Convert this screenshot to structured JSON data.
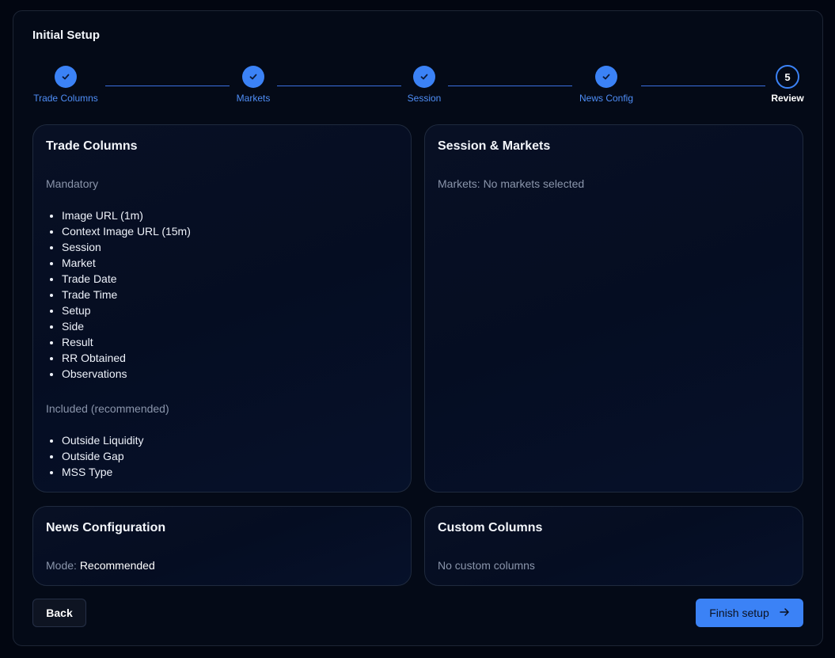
{
  "title": "Initial Setup",
  "steps": [
    {
      "label": "Trade Columns",
      "state": "done"
    },
    {
      "label": "Markets",
      "state": "done"
    },
    {
      "label": "Session",
      "state": "done"
    },
    {
      "label": "News Config",
      "state": "done"
    },
    {
      "label": "Review",
      "number": "5",
      "state": "current"
    }
  ],
  "trade_columns": {
    "title": "Trade Columns",
    "mandatory_label": "Mandatory",
    "mandatory": [
      "Image URL (1m)",
      "Context Image URL (15m)",
      "Session",
      "Market",
      "Trade Date",
      "Trade Time",
      "Setup",
      "Side",
      "Result",
      "RR Obtained",
      "Observations"
    ],
    "included_label": "Included (recommended)",
    "included": [
      "Outside Liquidity",
      "Outside Gap",
      "MSS Type"
    ]
  },
  "session_markets": {
    "title": "Session & Markets",
    "markets_text": "Markets: No markets selected"
  },
  "news": {
    "title": "News Configuration",
    "mode_label": "Mode:",
    "mode_value": "Recommended"
  },
  "custom_columns": {
    "title": "Custom Columns",
    "empty_text": "No custom columns"
  },
  "buttons": {
    "back": "Back",
    "finish": "Finish setup"
  },
  "colors": {
    "accent": "#3b82f6",
    "background": "#020611"
  }
}
